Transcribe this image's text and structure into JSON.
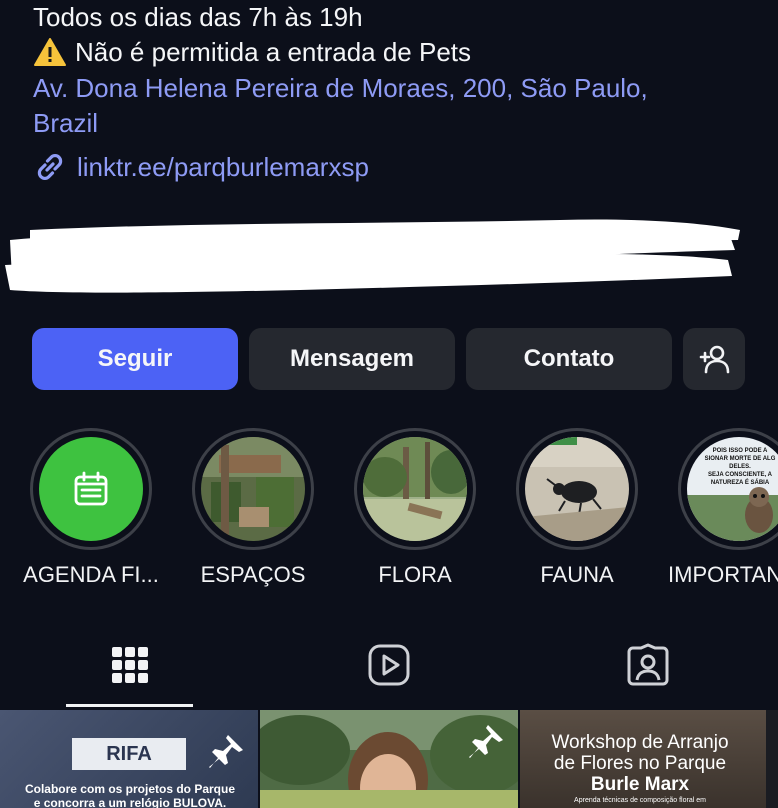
{
  "bio": {
    "hours": "Todos os dias das 7h às 19h",
    "pets_notice": "Não é permitida a entrada de Pets",
    "address_line1": "Av. Dona Helena Pereira de Moraes, 200, São Paulo,",
    "address_line2": "Brazil",
    "link": "linktr.ee/parqburlemarxsp"
  },
  "actions": {
    "follow": "Seguir",
    "message": "Mensagem",
    "contact": "Contato"
  },
  "highlights": [
    {
      "label": "AGENDA FI..."
    },
    {
      "label": "ESPAÇOS"
    },
    {
      "label": "FLORA"
    },
    {
      "label": "FAUNA"
    },
    {
      "label": "IMPORTAN"
    }
  ],
  "highlight_text": {
    "importan_story_lines": [
      "POIS ISSO PODE A",
      "SIONAR MORTE DE ALG",
      "DELES.",
      "SEJA CONSCIENTE, A",
      "NATUREZA É SÁBIA"
    ]
  },
  "posts": [
    {
      "badge": "RIFA",
      "caption_line1": "Colabore com os projetos do Parque",
      "caption_line2": "e concorra a um relógio BULOVA."
    },
    {},
    {
      "title_line1": "Workshop de Arranjo",
      "title_line2": "de Flores no Parque",
      "title_line3": "Burle Marx",
      "subtitle": "Aprenda técnicas de composição floral em"
    }
  ],
  "colors": {
    "background": "#0c0f1a",
    "accent": "#4c62f5",
    "link": "#8e9bf5",
    "button": "#25282f"
  }
}
